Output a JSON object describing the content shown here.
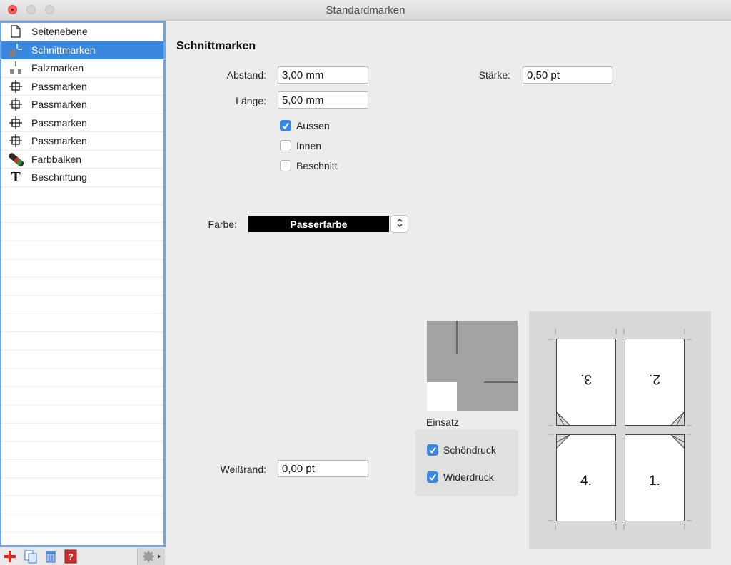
{
  "window": {
    "title": "Standardmarken"
  },
  "sidebar": {
    "items": [
      {
        "label": "Seitenebene",
        "icon": "page-icon"
      },
      {
        "label": "Schnittmarken",
        "icon": "crop-mark-icon",
        "selected": true
      },
      {
        "label": "Falzmarken",
        "icon": "fold-mark-icon"
      },
      {
        "label": "Passmarken",
        "icon": "registration-mark-icon"
      },
      {
        "label": "Passmarken",
        "icon": "registration-mark-icon"
      },
      {
        "label": "Passmarken",
        "icon": "registration-mark-icon"
      },
      {
        "label": "Passmarken",
        "icon": "registration-mark-icon"
      },
      {
        "label": "Farbbalken",
        "icon": "color-bar-icon"
      },
      {
        "label": "Beschriftung",
        "icon": "text-icon"
      }
    ],
    "toolbar": [
      "add-icon",
      "duplicate-icon",
      "trash-icon",
      "help-icon",
      "gear-icon"
    ]
  },
  "main": {
    "section_title": "Schnittmarken",
    "abstand_label": "Abstand:",
    "abstand_value": "3,00 mm",
    "laenge_label": "Länge:",
    "laenge_value": "5,00 mm",
    "staerke_label": "Stärke:",
    "staerke_value": "0,50 pt",
    "aussen": {
      "label": "Aussen",
      "checked": true
    },
    "innen": {
      "label": "Innen",
      "checked": false
    },
    "beschnitt": {
      "label": "Beschnitt",
      "checked": false
    },
    "farbe_label": "Farbe:",
    "farbe_value": "Passerfarbe",
    "weissrand_label": "Weißrand:",
    "weissrand_value": "0,00 pt",
    "einsatz_label": "Einsatz",
    "schoendruck": {
      "label": "Schöndruck",
      "checked": true
    },
    "widerdruck": {
      "label": "Widerdruck",
      "checked": true
    },
    "pages": [
      "3.",
      "2.",
      "4.",
      "1."
    ]
  },
  "colors": {
    "accent": "#3a87df",
    "sidebar_border": "#6aa5e8",
    "close": "#fd5f57"
  }
}
